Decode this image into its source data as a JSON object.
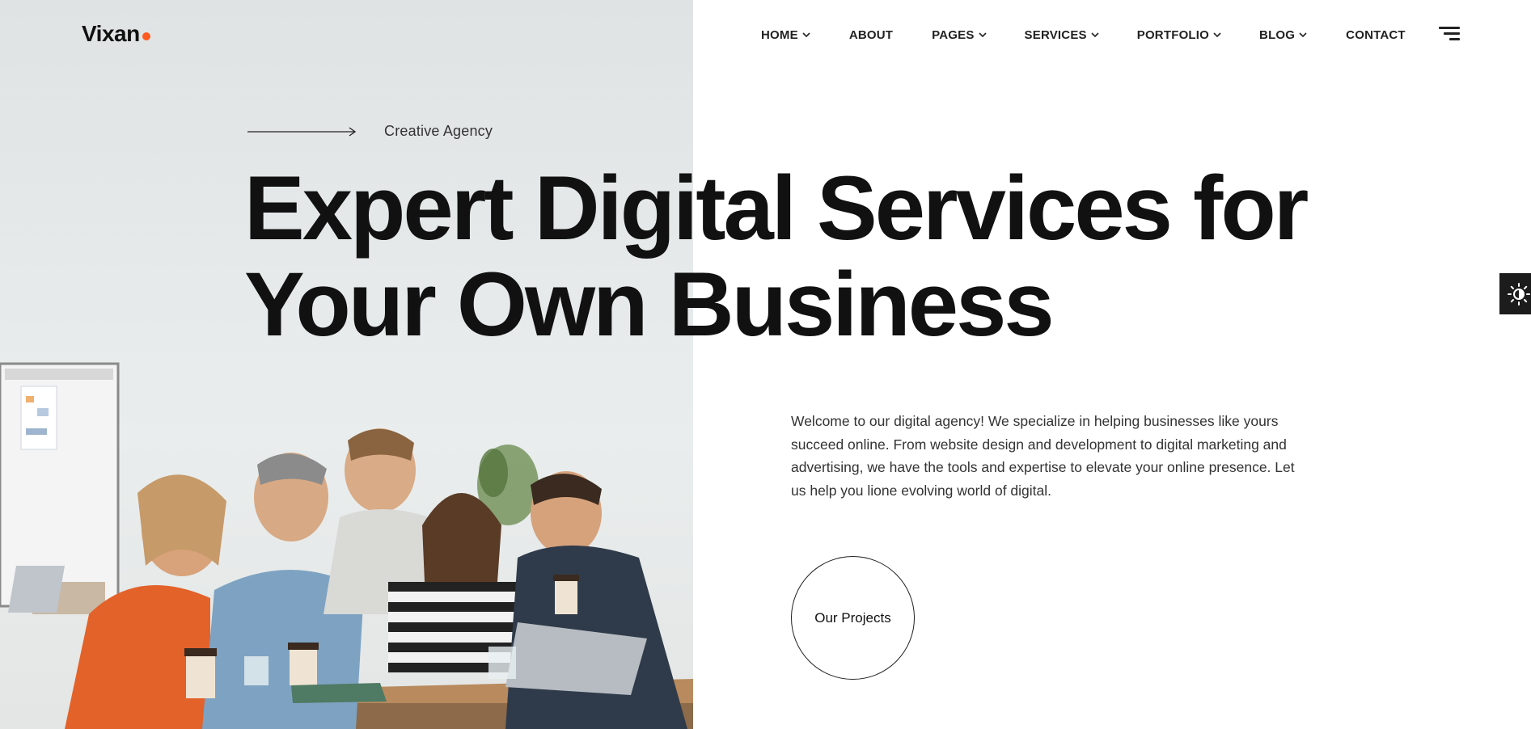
{
  "brand": {
    "name": "Vixan",
    "accent": "#ff5a1f"
  },
  "nav": {
    "items": [
      {
        "label": "HOME",
        "dropdown": true
      },
      {
        "label": "ABOUT",
        "dropdown": false
      },
      {
        "label": "PAGES",
        "dropdown": true
      },
      {
        "label": "SERVICES",
        "dropdown": true
      },
      {
        "label": "PORTFOLIO",
        "dropdown": true
      },
      {
        "label": "BLOG",
        "dropdown": true
      },
      {
        "label": "CONTACT",
        "dropdown": false
      }
    ],
    "menu_icon": "hamburger-menu-icon"
  },
  "hero": {
    "eyebrow": "Creative Agency",
    "headline_line1": "Expert Digital Services for",
    "headline_line2": "Your Own Business",
    "intro": "Welcome to our digital agency! We specialize in helping businesses like yours succeed online. From website design and development to digital marketing and advertising, we have the tools and expertise to elevate your online presence. Let us help you lione evolving world of digital.",
    "cta_label": "Our Projects",
    "image": "team-meeting-photo"
  },
  "theme_toggle": {
    "icon": "sun-icon"
  }
}
